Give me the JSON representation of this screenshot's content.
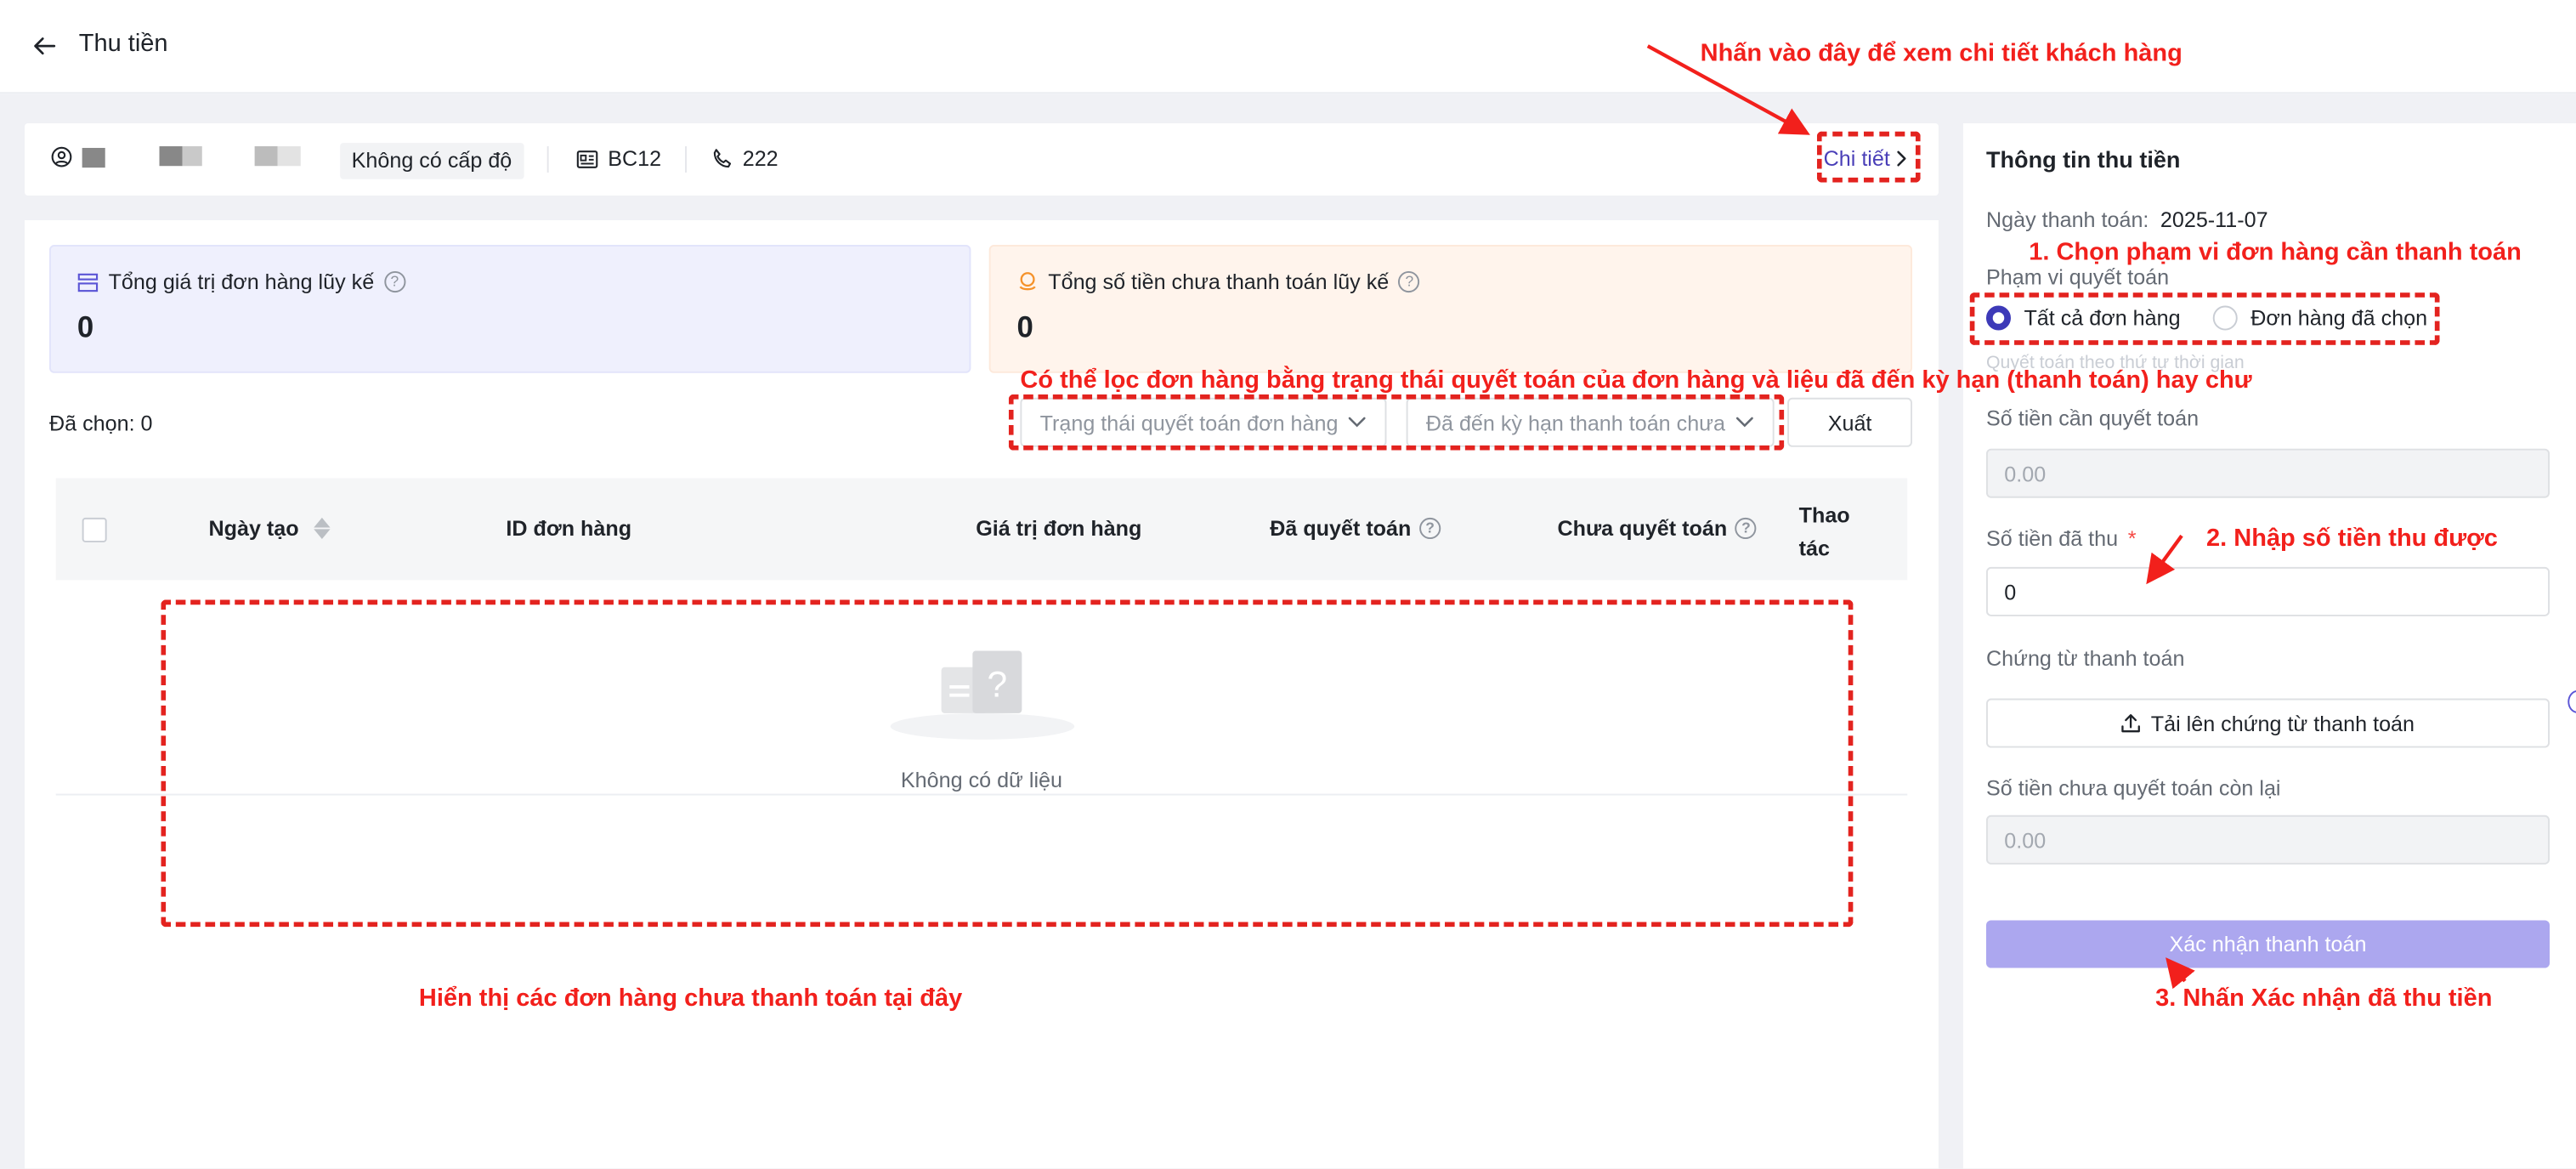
{
  "header": {
    "title": "Thu tiền"
  },
  "customer": {
    "level": "Không có cấp độ",
    "code": "BC12",
    "phone": "222",
    "detail_link": "Chi tiết"
  },
  "summary": {
    "total_order_value": {
      "label": "Tổng giá trị đơn hàng lũy kế",
      "value": "0"
    },
    "total_unpaid": {
      "label": "Tổng số tiền chưa thanh toán lũy kế",
      "value": "0"
    }
  },
  "filters": {
    "selected_count": "Đã chọn: 0",
    "settlement_status_placeholder": "Trạng thái quyết toán đơn hàng",
    "due_status_placeholder": "Đã đến kỳ hạn thanh toán chưa",
    "export_label": "Xuất"
  },
  "table": {
    "columns": [
      "Ngày tạo",
      "ID đơn hàng",
      "Giá trị đơn hàng",
      "Đã quyết toán",
      "Chưa quyết toán",
      "Thao tác"
    ],
    "rows": [],
    "empty_text": "Không có dữ liệu"
  },
  "payment_panel": {
    "title": "Thông tin thu tiền",
    "payment_date_label": "Ngày thanh toán:",
    "payment_date_value": "2025-11-07",
    "scope_label": "Phạm vi quyết toán",
    "scope_options": [
      "Tất cả đơn hàng",
      "Đơn hàng đã chọn"
    ],
    "scope_selected": "Tất cả đơn hàng",
    "scope_hint": "Quyết toán theo thứ tự thời gian",
    "amount_to_settle_label": "Số tiền cần quyết toán",
    "amount_to_settle_value": "0.00",
    "amount_received_label": "Số tiền đã thu",
    "amount_received_value": "0",
    "required_mark": "*",
    "voucher_label": "Chứng từ thanh toán",
    "upload_label": "Tải lên chứng từ thanh toán",
    "remaining_label": "Số tiền chưa quyết toán còn lại",
    "remaining_value": "0.00",
    "confirm_label": "Xác nhận thanh toán"
  },
  "annotations": {
    "detail": "Nhấn vào đây để xem chi tiết khách hàng",
    "filter": "Có thể lọc đơn hàng bằng trạng thái quyết toán của đơn hàng và liệu đã đến kỳ hạn (thanh toán) hay chư",
    "table": "Hiển thị các đơn hàng chưa thanh toán tại đây",
    "step1": "1. Chọn phạm vi đơn hàng cần thanh toán",
    "step2": "2. Nhập số tiền thu được",
    "step3": "3. Nhấn Xác nhận đã thu tiền"
  },
  "colors": {
    "accent": "#3d3ab8",
    "annotation_red": "#f2201c",
    "confirm_bg": "#aca7ef"
  }
}
